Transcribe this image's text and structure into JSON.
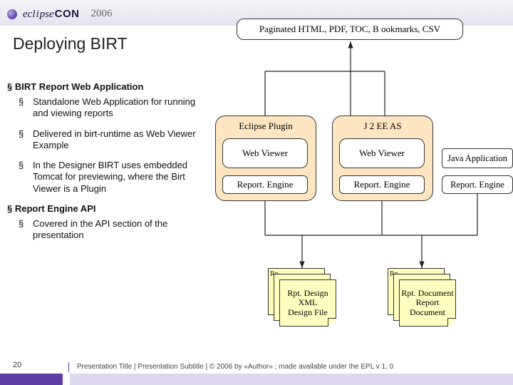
{
  "header": {
    "logo_prefix": "ecl",
    "logo_dot": "i",
    "logo_rest": "pse",
    "logo_con": "CON",
    "year": "2006"
  },
  "title": "Deploying BIRT",
  "top_box": "Paginated HTML, PDF, TOC, B ookmarks, CSV",
  "sections": [
    {
      "heading": "BIRT Report Web Application",
      "bullets": [
        "Standalone Web Application for running and viewing reports",
        "Delivered in birt-runtime as Web Viewer Example",
        "In the Designer BIRT uses embedded Tomcat for previewing, where the Birt Viewer is a Plugin"
      ]
    },
    {
      "heading": "Report Engine API",
      "bullets": [
        "Covered in the API section of the presentation"
      ]
    }
  ],
  "diagram": {
    "container_a_label": "Eclipse Plugin",
    "container_b_label": "J 2 EE AS",
    "web_viewer": "Web Viewer",
    "report_engine": "Report. Engine",
    "java_app": "Java Application",
    "file_a_corner": "Rp",
    "file_a_lines": [
      "Rpt. Design",
      "XML",
      "Design File"
    ],
    "file_b_corner": "Rp",
    "file_b_lines": [
      "Rpt. Document",
      "Report",
      "Document"
    ]
  },
  "footer": {
    "page": "20",
    "text": "Presentation Title  |  Presentation Subtitle  |  © 2006 by «Author» ; made available under the EPL v 1. 0"
  }
}
